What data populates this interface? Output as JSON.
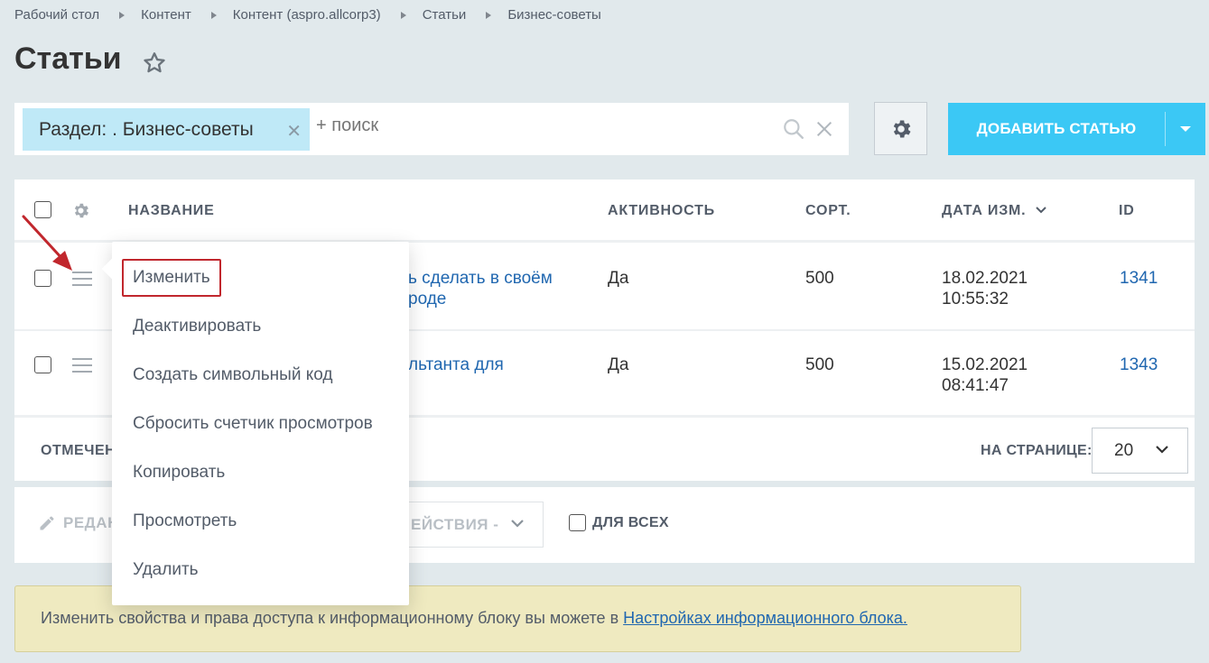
{
  "breadcrumb": [
    "Рабочий стол",
    "Контент",
    "Контент (aspro.allcorp3)",
    "Статьи",
    "Бизнес-советы"
  ],
  "page": {
    "title": "Статьи"
  },
  "filter": {
    "chip_label": "Раздел: . Бизнес-советы",
    "search_placeholder": "+ поиск"
  },
  "toolbar": {
    "add_label": "ДОБАВИТЬ СТАТЬЮ"
  },
  "grid": {
    "columns": {
      "name": "НАЗВАНИЕ",
      "active": "АКТИВНОСТЬ",
      "sort": "СОРТ.",
      "date": "ДАТА ИЗМ.",
      "id": "ID"
    },
    "rows": [
      {
        "name_line1": "ь сделать в своём",
        "name_line2": "роде",
        "active": "Да",
        "sort": "500",
        "date": "18.02.2021",
        "time": "10:55:32",
        "id": "1341"
      },
      {
        "name_line1": "льтанта для",
        "name_line2": "",
        "active": "Да",
        "sort": "500",
        "date": "15.02.2021",
        "time": "08:41:47",
        "id": "1343"
      }
    ],
    "footer": {
      "marked_label": "ОТМЕЧЕН",
      "per_page_label": "НА СТРАНИЦЕ:",
      "per_page_value": "20"
    }
  },
  "actions": {
    "edit_label": "РЕДАК",
    "select_label": "ЕЙСТВИЯ -",
    "for_all_label": "ДЛЯ ВСЕХ"
  },
  "context_menu": {
    "items": [
      "Изменить",
      "Деактивировать",
      "Создать символьный код",
      "Сбросить счетчик просмотров",
      "Копировать",
      "Просмотреть",
      "Удалить"
    ],
    "highlighted": "Изменить"
  },
  "notice": {
    "text": "Изменить свойства и права доступа к информационному блоку вы можете в ",
    "link_label": "Настройках информационного блока."
  },
  "colors": {
    "background": "#e1e9ec",
    "accent": "#3bc8f5",
    "chip": "#bfe9f7",
    "link": "#2067b0",
    "highlight": "#c1272d",
    "notice": "#efeac0"
  },
  "icons": [
    "star-icon",
    "search-icon",
    "close-icon",
    "gear-icon",
    "chevron-down-icon",
    "pencil-icon",
    "menu-icon",
    "arrow-annotation"
  ]
}
